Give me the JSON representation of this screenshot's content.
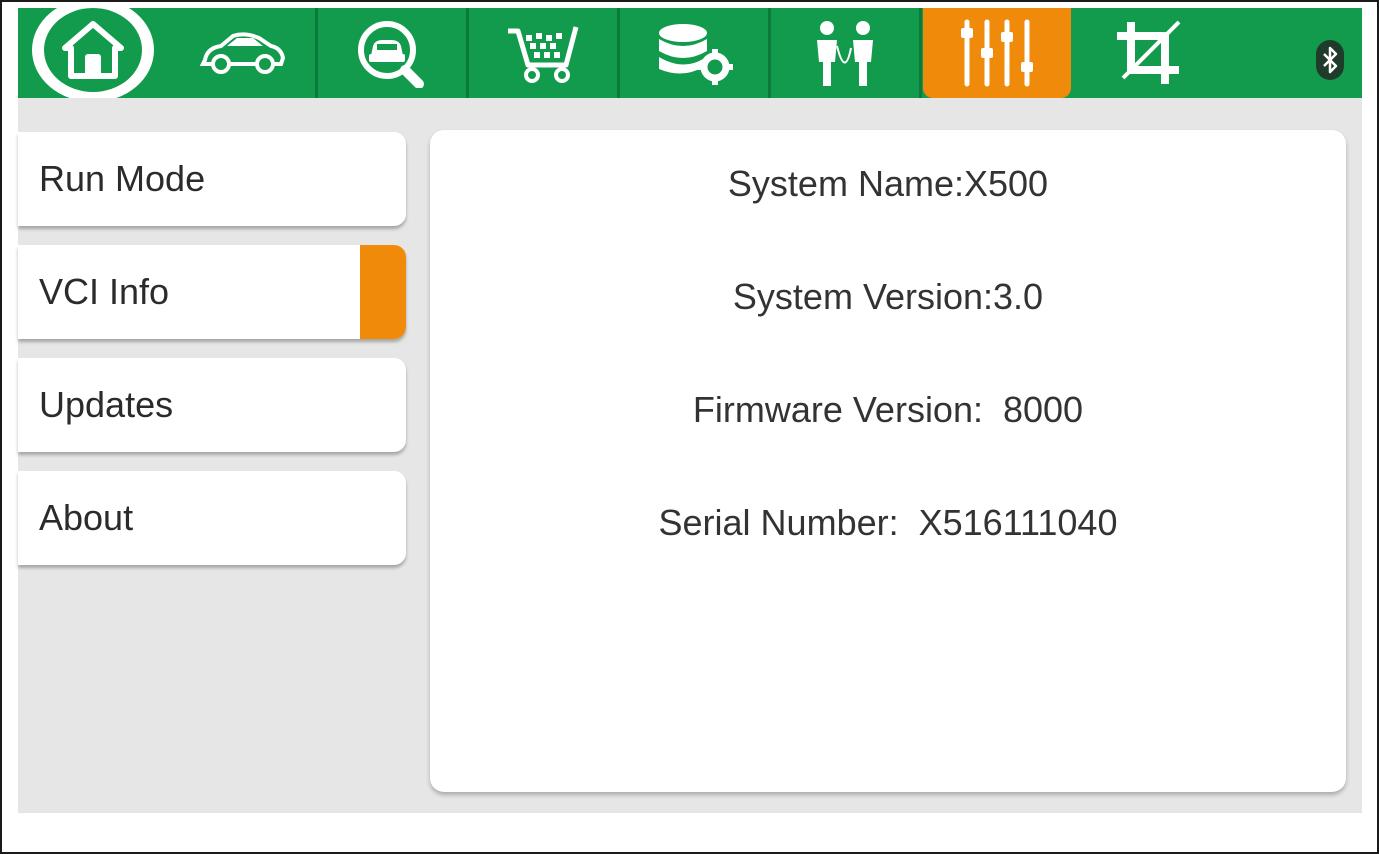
{
  "toolbar": {
    "tabs": [
      {
        "icon": "home-icon"
      },
      {
        "icon": "car-icon"
      },
      {
        "icon": "car-search-icon"
      },
      {
        "icon": "shopping-cart-icon"
      },
      {
        "icon": "database-settings-icon"
      },
      {
        "icon": "remote-assist-icon"
      },
      {
        "icon": "settings-sliders-icon",
        "active": true
      },
      {
        "icon": "crop-icon"
      }
    ],
    "status_icon": "bluetooth-icon"
  },
  "menu": {
    "items": [
      {
        "label": "Run Mode"
      },
      {
        "label": "VCI Info",
        "active": true
      },
      {
        "label": "Updates"
      },
      {
        "label": "About"
      }
    ]
  },
  "info": {
    "system_name": "System Name:X500",
    "system_version": "System Version:3.0",
    "firmware_version": "Firmware Version:  8000",
    "serial_number": "Serial Number:  X516111040"
  },
  "colors": {
    "toolbar_green": "#129b4d",
    "accent_orange": "#f08a0b",
    "content_bg": "#e6e6e6"
  }
}
